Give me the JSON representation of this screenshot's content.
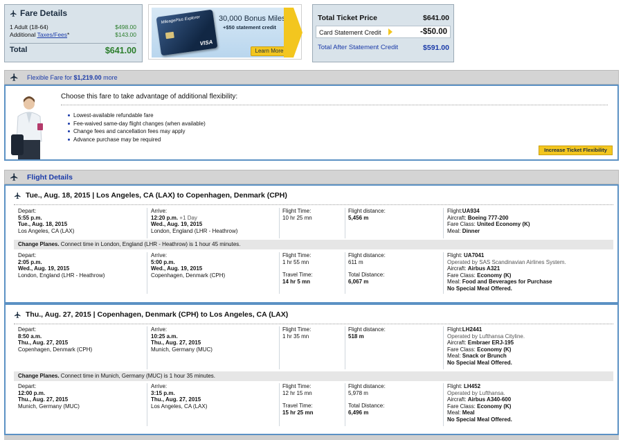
{
  "fare_details": {
    "title": "Fare Details",
    "adult_label": "1 Adult (18-64)",
    "adult_value": "$498.00",
    "additional_label": "Additional",
    "taxes_link": "Taxes/Fees",
    "taxes_suffix": "*",
    "taxes_value": "$143.00",
    "total_label": "Total",
    "total_value": "$641.00"
  },
  "promo": {
    "title": "30,000 Bonus Miles",
    "subtitle": "+$50 statement credit",
    "card_name": "MileagePlus Explorer",
    "card_brand": "VISA",
    "button": "Learn More"
  },
  "price_summary": {
    "total_ticket_label": "Total Ticket Price",
    "total_ticket_value": "$641.00",
    "statement_credit_label": "Card Statement Credit",
    "statement_credit_value": "-$50.00",
    "after_credit_label": "Total After Statement Credit",
    "after_credit_value": "$591.00"
  },
  "flexible_fare": {
    "bar_prefix": "Flexible Fare for ",
    "bar_amount": "$1,219.00",
    "bar_suffix": " more",
    "heading": "Choose this fare to take advantage of additional flexibility:",
    "bullets": [
      "Lowest-available refundable fare",
      "Fee-waived same-day flight changes (when available)",
      "Change fees and cancellation fees may apply",
      "Advance purchase may be required"
    ],
    "button": "Increase Ticket Flexibility"
  },
  "flight_details": {
    "title": "Flight Details",
    "trips": [
      {
        "header": "Tue., Aug. 18, 2015 | Los Angeles, CA (LAX) to Copenhagen, Denmark (CPH)",
        "segments": [
          {
            "depart_label": "Depart:",
            "depart_time": "5:55 p.m.",
            "depart_date": "Tue., Aug. 18, 2015",
            "depart_city": "Los Angeles, CA (LAX)",
            "arrive_label": "Arrive:",
            "arrive_time": "12:20 p.m.",
            "arrive_note": " +1 Day",
            "arrive_date": "Wed., Aug. 19, 2015",
            "arrive_city": "London, England (LHR - Heathrow)",
            "flight_time_label": "Flight Time:",
            "flight_time": "10 hr 25 mn",
            "travel_time_label": "",
            "travel_time": "",
            "distance_label": "Flight distance:",
            "distance": "5,456 m",
            "total_distance_label": "",
            "total_distance": "",
            "flight_label": "Flight:",
            "flight_no": "UA934",
            "operated_by": "",
            "aircraft_label": "Aircraft: ",
            "aircraft": "Boeing 777-200",
            "fare_class_label": "Fare Class: ",
            "fare_class": "United Economy (K)",
            "meal_label": "Meal: ",
            "meal": "Dinner",
            "meal_note": ""
          },
          {
            "depart_label": "Depart:",
            "depart_time": "2:05 p.m.",
            "depart_date": "Wed., Aug. 19, 2015",
            "depart_city": "London, England (LHR - Heathrow)",
            "arrive_label": "Arrive:",
            "arrive_time": "5:00 p.m.",
            "arrive_note": "",
            "arrive_date": "Wed., Aug. 19, 2015",
            "arrive_city": "Copenhagen, Denmark (CPH)",
            "flight_time_label": "Flight Time:",
            "flight_time": "1 hr 55 mn",
            "travel_time_label": "Travel Time:",
            "travel_time": "14 hr 5 mn",
            "distance_label": "Flight distance:",
            "distance": "611 m",
            "total_distance_label": "Total Distance:",
            "total_distance": "6,067 m",
            "flight_label": "Flight: ",
            "flight_no": "UA7041",
            "operated_by": "Operated by SAS Scandinavian Airlines System.",
            "aircraft_label": "Aircraft: ",
            "aircraft": "Airbus A321",
            "fare_class_label": "Fare Class: ",
            "fare_class": "Economy (K)",
            "meal_label": "Meal: ",
            "meal": "Food and Beverages for Purchase",
            "meal_note": "No Special Meal Offered."
          }
        ],
        "change_planes_label": "Change Planes.",
        "change_planes_text": " Connect time in London, England (LHR - Heathrow) is 1 hour 45 minutes."
      },
      {
        "header": "Thu., Aug. 27, 2015 | Copenhagen, Denmark (CPH) to Los Angeles, CA (LAX)",
        "segments": [
          {
            "depart_label": "Depart:",
            "depart_time": "8:50 a.m.",
            "depart_date": "Thu., Aug. 27, 2015",
            "depart_city": "Copenhagen, Denmark (CPH)",
            "arrive_label": "Arrive:",
            "arrive_time": "10:25 a.m.",
            "arrive_note": "",
            "arrive_date": "Thu., Aug. 27, 2015",
            "arrive_city": "Munich, Germany (MUC)",
            "flight_time_label": "Flight Time:",
            "flight_time": "1 hr 35 mn",
            "travel_time_label": "",
            "travel_time": "",
            "distance_label": "Flight distance:",
            "distance": "518 m",
            "total_distance_label": "",
            "total_distance": "",
            "flight_label": "Flight:",
            "flight_no": "LH2441",
            "operated_by": "Operated by Lufthansa Cityline.",
            "aircraft_label": "Aircraft: ",
            "aircraft": "Embraer ERJ-195",
            "fare_class_label": "Fare Class: ",
            "fare_class": "Economy (K)",
            "meal_label": "Meal: ",
            "meal": "Snack or Brunch",
            "meal_note": "No Special Meal Offered."
          },
          {
            "depart_label": "Depart:",
            "depart_time": "12:00 p.m.",
            "depart_date": "Thu., Aug. 27, 2015",
            "depart_city": "Munich, Germany (MUC)",
            "arrive_label": "Arrive:",
            "arrive_time": "3:15 p.m.",
            "arrive_note": "",
            "arrive_date": "Thu., Aug. 27, 2015",
            "arrive_city": "Los Angeles, CA (LAX)",
            "flight_time_label": "Flight Time:",
            "flight_time": "12 hr 15 mn",
            "travel_time_label": "Travel Time:",
            "travel_time": "15 hr 25 mn",
            "distance_label": "Flight distance:",
            "distance": "5,978 m",
            "total_distance_label": "Total Distance:",
            "total_distance": "6,496 m",
            "flight_label": "Flight: ",
            "flight_no": "LH452",
            "operated_by": "Operated by Lufthansa.",
            "aircraft_label": "Aircraft: ",
            "aircraft": "Airbus A340-600",
            "fare_class_label": "Fare Class: ",
            "fare_class": "Economy (K)",
            "meal_label": "Meal: ",
            "meal": "Meal",
            "meal_note": "No Special Meal Offered."
          }
        ],
        "change_planes_label": "Change Planes.",
        "change_planes_text": " Connect time in Munich, Germany (MUC) is 1 hour 35 minutes."
      }
    ]
  },
  "icons": {
    "plane": "airplane-icon"
  },
  "colors": {
    "accent_blue": "#5b91c4",
    "money_green": "#2b7d2b",
    "cta_yellow": "#f3c61f",
    "link_blue": "#1a3aa8"
  }
}
